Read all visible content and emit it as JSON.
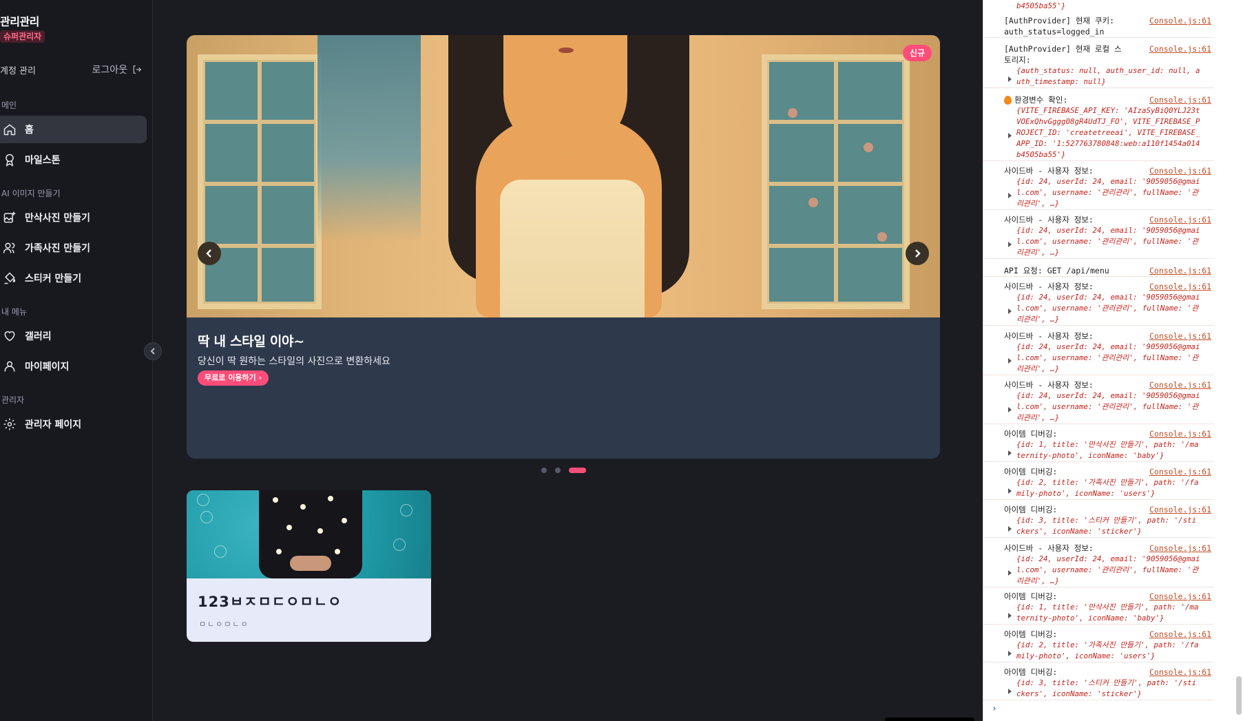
{
  "sidebar": {
    "brand": "관리관리",
    "role": "슈퍼관리자",
    "account_label": "계정 관리",
    "logout_label": "로그아웃",
    "sections": {
      "main": "메인",
      "ai": "AI 이미지 만들기",
      "my": "내 메뉴",
      "admin": "관리자"
    },
    "items": {
      "home": "홈",
      "milestone": "마일스톤",
      "maternity": "만삭사진 만들기",
      "family": "가족사진 만들기",
      "sticker": "스티커 만들기",
      "gallery": "갤러리",
      "mypage": "마이페이지",
      "admin_page": "관리자 페이지"
    }
  },
  "banner": {
    "badge": "신규",
    "title": "딱 내 스타일 이야~",
    "subtitle": "당신이 딱 원하는 스타일의 사진으로 변환하세요",
    "cta": "무료로 이용하기",
    "slide_count": 3,
    "active_slide": 3
  },
  "card": {
    "title": "123ㅂㅈㅁㄷㅇㅁㄴㅇ",
    "subtitle": "ㅁㄴㅇㅁㄴㅇ"
  },
  "console": {
    "top_fragment": "b4505ba55'}",
    "entries": [
      {
        "msg": "[AuthProvider] 현재 쿠키:",
        "msg2": "auth_status=logged_in",
        "link": "Console.js:61",
        "obj": ""
      },
      {
        "msg": "[AuthProvider] 현재 로컬 스",
        "msg2": "토리지:",
        "link": "Console.js:61",
        "obj": "{auth_status: null, auth_user_id: null, auth_timestamp: null}"
      },
      {
        "msg": "환경변수 확인:",
        "msg2": "",
        "link": "Console.js:61",
        "obj": "{VITE_FIREBASE_API_KEY: 'AIzaSyBiQ0YLJ23tVOExQhvGggg08gR4UdTJ_FO', VITE_FIREBASE_PROJECT_ID: 'createtreeai', VITE_FIREBASE_APP_ID: '1:527763780848:web:a110f1454a014b4505ba55'}"
      },
      {
        "msg": "사이드바 - 사용자 정보:",
        "msg2": "",
        "link": "Console.js:61",
        "obj": "{id: 24, userId: 24, email: '9059056@gmail.com', username: '관리관리', fullName: '관리관리', …}"
      },
      {
        "msg": "사이드바 - 사용자 정보:",
        "msg2": "",
        "link": "Console.js:61",
        "obj": "{id: 24, userId: 24, email: '9059056@gmail.com', username: '관리관리', fullName: '관리관리', …}"
      },
      {
        "msg": "API 요청: GET /api/menu",
        "msg2": "",
        "link": "Console.js:61",
        "obj": ""
      },
      {
        "msg": "사이드바 - 사용자 정보:",
        "msg2": "",
        "link": "Console.js:61",
        "obj": "{id: 24, userId: 24, email: '9059056@gmail.com', username: '관리관리', fullName: '관리관리', …}"
      },
      {
        "msg": "사이드바 - 사용자 정보:",
        "msg2": "",
        "link": "Console.js:61",
        "obj": "{id: 24, userId: 24, email: '9059056@gmail.com', username: '관리관리', fullName: '관리관리', …}"
      },
      {
        "msg": "사이드바 - 사용자 정보:",
        "msg2": "",
        "link": "Console.js:61",
        "obj": "{id: 24, userId: 24, email: '9059056@gmail.com', username: '관리관리', fullName: '관리관리', …}"
      },
      {
        "msg": "아이템 디버깅:",
        "msg2": "",
        "link": "Console.js:61",
        "obj": "{id: 1, title: '만삭사진 만들기', path: '/maternity-photo', iconName: 'baby'}"
      },
      {
        "msg": "아이템 디버깅:",
        "msg2": "",
        "link": "Console.js:61",
        "obj": "{id: 2, title: '가족사진 만들기', path: '/family-photo', iconName: 'users'}"
      },
      {
        "msg": "아이템 디버깅:",
        "msg2": "",
        "link": "Console.js:61",
        "obj": "{id: 3, title: '스티커 만들기', path: '/stickers', iconName: 'sticker'}"
      },
      {
        "msg": "사이드바 - 사용자 정보:",
        "msg2": "",
        "link": "Console.js:61",
        "obj": "{id: 24, userId: 24, email: '9059056@gmail.com', username: '관리관리', fullName: '관리관리', …}"
      },
      {
        "msg": "아이템 디버깅:",
        "msg2": "",
        "link": "Console.js:61",
        "obj": "{id: 1, title: '만삭사진 만들기', path: '/maternity-photo', iconName: 'baby'}"
      },
      {
        "msg": "아이템 디버깅:",
        "msg2": "",
        "link": "Console.js:61",
        "obj": "{id: 2, title: '가족사진 만들기', path: '/family-photo', iconName: 'users'}"
      },
      {
        "msg": "아이템 디버깅:",
        "msg2": "",
        "link": "Console.js:61",
        "obj": "{id: 3, title: '스티커 만들기', path: '/stickers', iconName: 'sticker'}"
      }
    ]
  },
  "colors": {
    "accent": "#ff4d7a",
    "sidebar_bg": "#18191f",
    "main_bg": "#1b1c22",
    "banner_caption_bg": "#2e3a4c"
  }
}
